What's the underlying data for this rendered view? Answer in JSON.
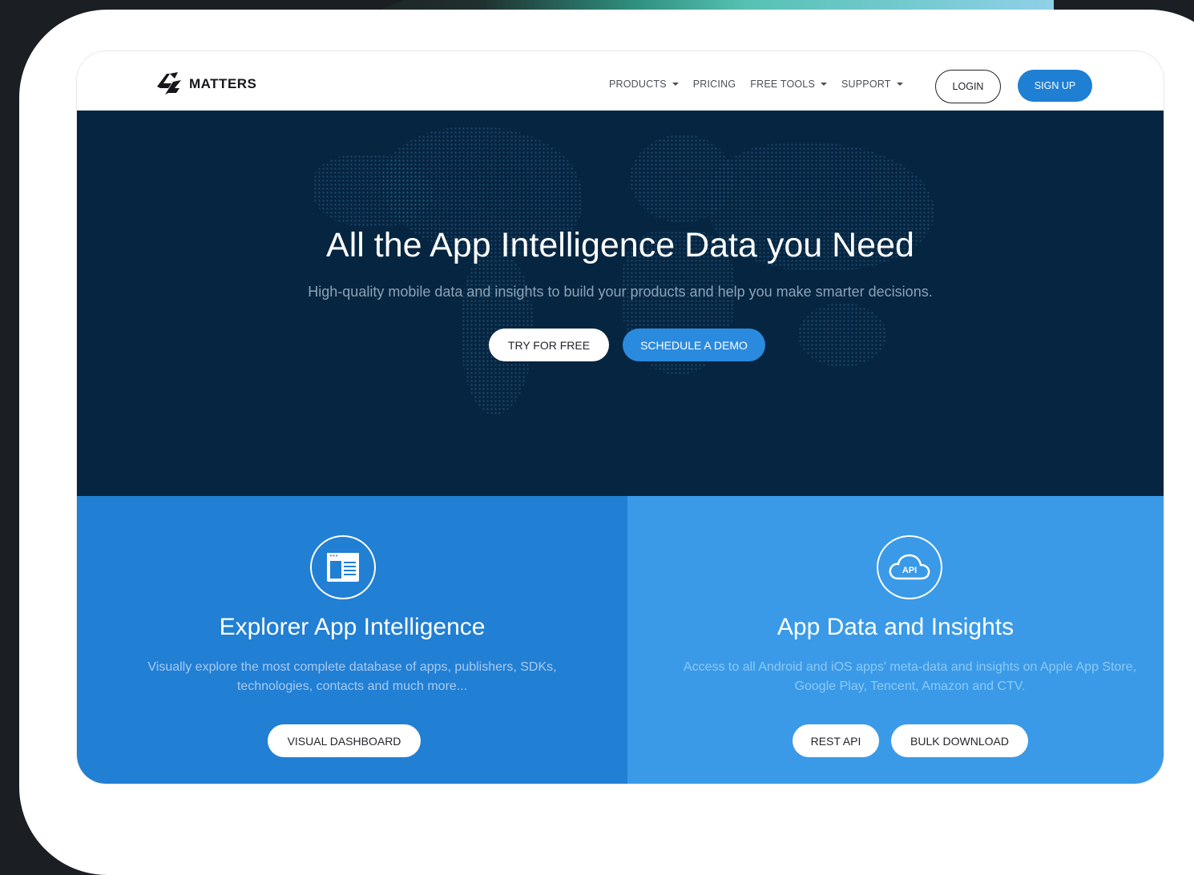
{
  "brand": {
    "name": "MATTERS",
    "logo_icon": "42-logo-icon"
  },
  "nav": {
    "items": [
      {
        "label": "PRODUCTS",
        "dropdown": true
      },
      {
        "label": "PRICING",
        "dropdown": false
      },
      {
        "label": "FREE TOOLS",
        "dropdown": true
      },
      {
        "label": "SUPPORT",
        "dropdown": true
      }
    ],
    "login_label": "LOGIN",
    "signup_label": "SIGN UP"
  },
  "hero": {
    "title": "All the App Intelligence Data you Need",
    "subtitle": "High-quality mobile data and insights to build your products and help you make smarter decisions.",
    "try_label": "TRY FOR FREE",
    "demo_label": "SCHEDULE A DEMO"
  },
  "panels": {
    "explorer": {
      "icon": "dashboard-window-icon",
      "title": "Explorer App Intelligence",
      "description": "Visually explore the most complete database of apps, publishers, SDKs, technologies, contacts and much more...",
      "button_label": "VISUAL DASHBOARD"
    },
    "data": {
      "icon": "api-cloud-icon",
      "icon_text": "API",
      "title": "App Data and Insights",
      "description": "Access to all Android and iOS apps' meta-data and insights on Apple App Store, Google Play, Tencent, Amazon and CTV.",
      "rest_label": "REST API",
      "bulk_label": "BULK DOWNLOAD"
    }
  },
  "colors": {
    "hero_bg": "#062540",
    "accent": "#1f7fd3",
    "panel_left": "#217fd4",
    "panel_right": "#3a9ae7"
  }
}
